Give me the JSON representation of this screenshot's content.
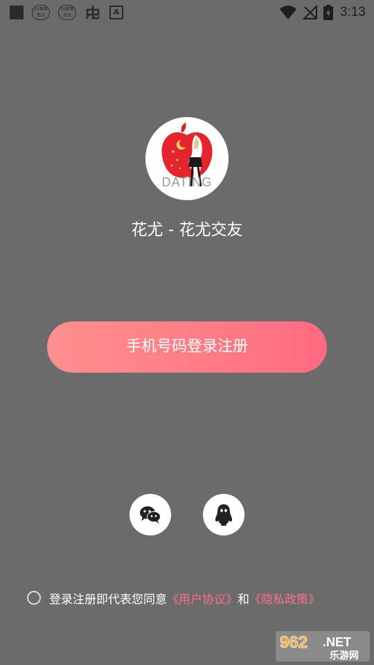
{
  "status_bar": {
    "time": "3:13",
    "badge_top": "55赛事",
    "badge_bottom": "资讯",
    "a_icon": "A"
  },
  "app": {
    "title": "花尤 - 花尤交友",
    "logo_text": "DATING"
  },
  "login": {
    "phone_button_label": "手机号码登录注册"
  },
  "agreement": {
    "prefix": "登录注册即代表您同意",
    "user_agreement": "《用户协议》",
    "conjunction": "和",
    "privacy_policy": "《隐私政策》"
  },
  "colors": {
    "background": "#6b6b6b",
    "accent": "#ff6f8a",
    "button_gradient_start": "#ff8f8f",
    "button_gradient_end": "#ff6a82"
  },
  "watermark": {
    "number": "962",
    "suffix": ".NET",
    "subtitle": "乐游网"
  }
}
